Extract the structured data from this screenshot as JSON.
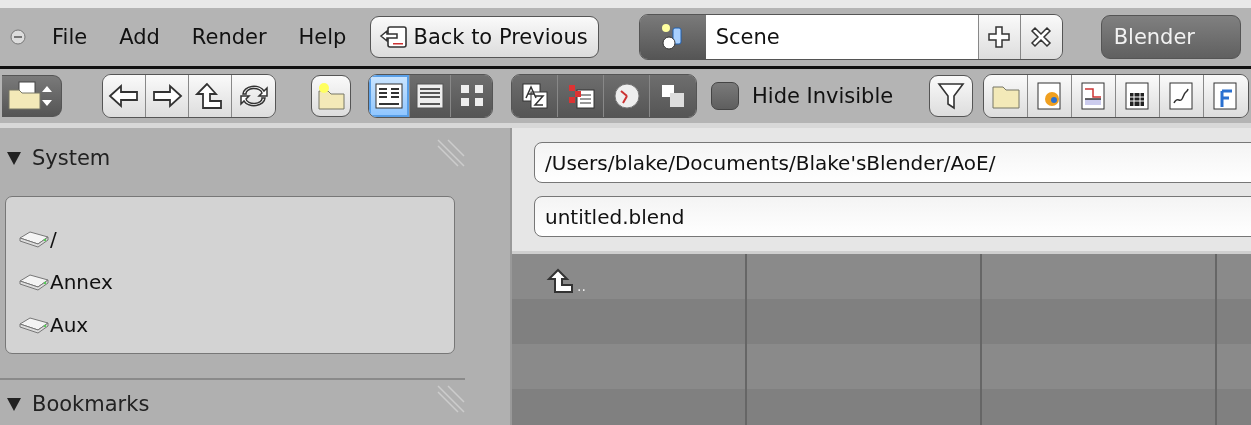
{
  "header": {
    "menus": [
      "File",
      "Add",
      "Render",
      "Help"
    ],
    "back_button": "Back to Previous",
    "scene": {
      "value": "Scene"
    },
    "engine": "Blender"
  },
  "toolbar": {
    "display_modes": [
      {
        "selected": true
      },
      {
        "selected": false
      },
      {
        "selected": false
      }
    ],
    "hide_invisible": {
      "label": "Hide Invisible",
      "checked": false
    }
  },
  "sidebar": {
    "sections": [
      {
        "title": "System",
        "expanded": true,
        "items": [
          "/",
          "Annex",
          "Aux"
        ]
      },
      {
        "title": "Bookmarks",
        "expanded": true
      }
    ]
  },
  "path": {
    "directory": "/Users/blake/Documents/Blake'sBlender/AoE/",
    "filename": "untitled.blend"
  },
  "files": [
    {
      "name": "..",
      "kind": "parent"
    }
  ]
}
